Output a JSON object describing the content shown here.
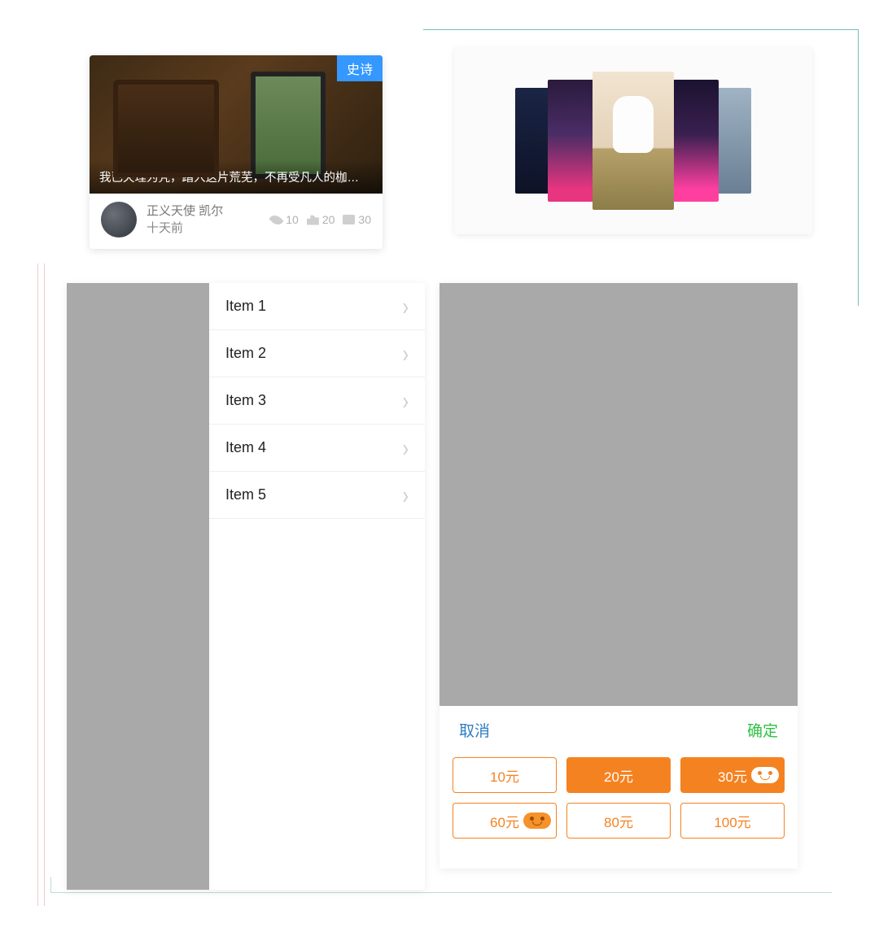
{
  "card1": {
    "badge": "史诗",
    "caption": "我已天理为凭，踏入这片荒芜，不再受凡人的枷…",
    "author_name": "正义天使 凯尔",
    "time_ago": "十天前",
    "views": "10",
    "likes": "20",
    "comments": "30"
  },
  "list": {
    "items": [
      {
        "label": "Item 1"
      },
      {
        "label": "Item 2"
      },
      {
        "label": "Item 3"
      },
      {
        "label": "Item 4"
      },
      {
        "label": "Item 5"
      }
    ]
  },
  "sheet": {
    "cancel": "取消",
    "confirm": "确定",
    "amounts": [
      {
        "label": "10元",
        "solid": false,
        "badge": false
      },
      {
        "label": "20元",
        "solid": true,
        "badge": false
      },
      {
        "label": "30元",
        "solid": true,
        "badge": true
      },
      {
        "label": "60元",
        "solid": false,
        "badge": true
      },
      {
        "label": "80元",
        "solid": false,
        "badge": false
      },
      {
        "label": "100元",
        "solid": false,
        "badge": false
      }
    ]
  }
}
